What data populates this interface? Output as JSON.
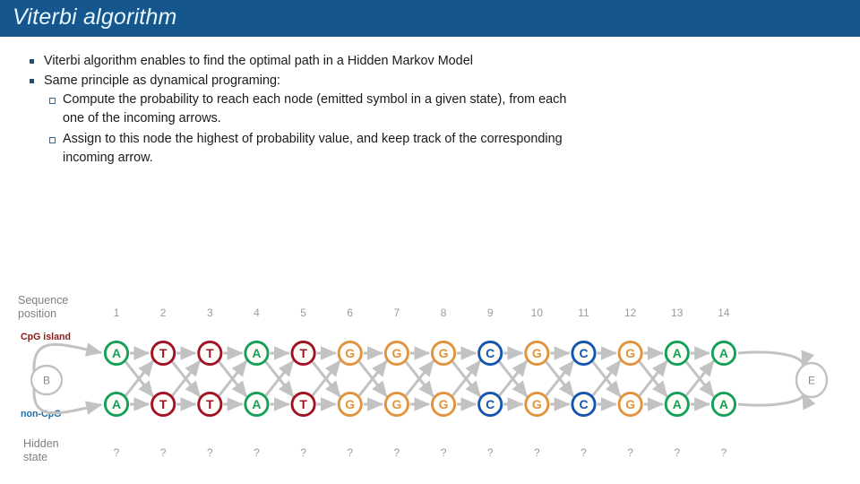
{
  "slide": {
    "title": "Viterbi algorithm",
    "title_bar_color": "#15578c",
    "title_text_color": "#e8f7ff",
    "background_color": "#ffffff"
  },
  "bullets": [
    {
      "level": 1,
      "text": "Viterbi algorithm enables to find the optimal path in a Hidden Markov Model"
    },
    {
      "level": 1,
      "text": "Same principle as dynamical programing:"
    },
    {
      "level": 2,
      "text": "Compute the probability to reach each node (emitted symbol in a given state), from each one of the incoming arrows."
    },
    {
      "level": 2,
      "text": "Assign to this node the highest of probability value, and keep track of the corresponding incoming arrow."
    }
  ],
  "diagram": {
    "labels": {
      "sequence_position_line1": "Sequence",
      "sequence_position_line2": "position",
      "hidden_state_line1": "Hidden",
      "hidden_state_line2": "state",
      "cpg_island": "CpG island",
      "non_cpg": "non-CpG",
      "begin_node": "B",
      "end_node": "E"
    },
    "label_colors": {
      "cpg_island": "#8c1a1a",
      "non_cpg": "#1a6ca8",
      "gray_text": "#7f7f7f",
      "arrow": "#c2c2c2"
    },
    "positions": [
      "1",
      "2",
      "3",
      "4",
      "5",
      "6",
      "7",
      "8",
      "9",
      "10",
      "11",
      "12",
      "13",
      "14"
    ],
    "hidden_states": [
      "?",
      "?",
      "?",
      "?",
      "?",
      "?",
      "?",
      "?",
      "?",
      "?",
      "?",
      "?",
      "?",
      "?"
    ],
    "sequence": [
      "A",
      "T",
      "T",
      "A",
      "T",
      "G",
      "G",
      "G",
      "C",
      "G",
      "C",
      "G",
      "A",
      "A"
    ],
    "base_colors": {
      "A": "#15a05a",
      "T": "#a11224",
      "G": "#e09440",
      "C": "#1455ad"
    },
    "rows": [
      {
        "name": "cpg-island-row",
        "symbols": [
          "A",
          "T",
          "T",
          "A",
          "T",
          "G",
          "G",
          "G",
          "C",
          "G",
          "C",
          "G",
          "A",
          "A"
        ]
      },
      {
        "name": "non-cpg-row",
        "symbols": [
          "A",
          "T",
          "T",
          "A",
          "T",
          "G",
          "G",
          "G",
          "C",
          "G",
          "C",
          "G",
          "A",
          "A"
        ]
      }
    ]
  }
}
